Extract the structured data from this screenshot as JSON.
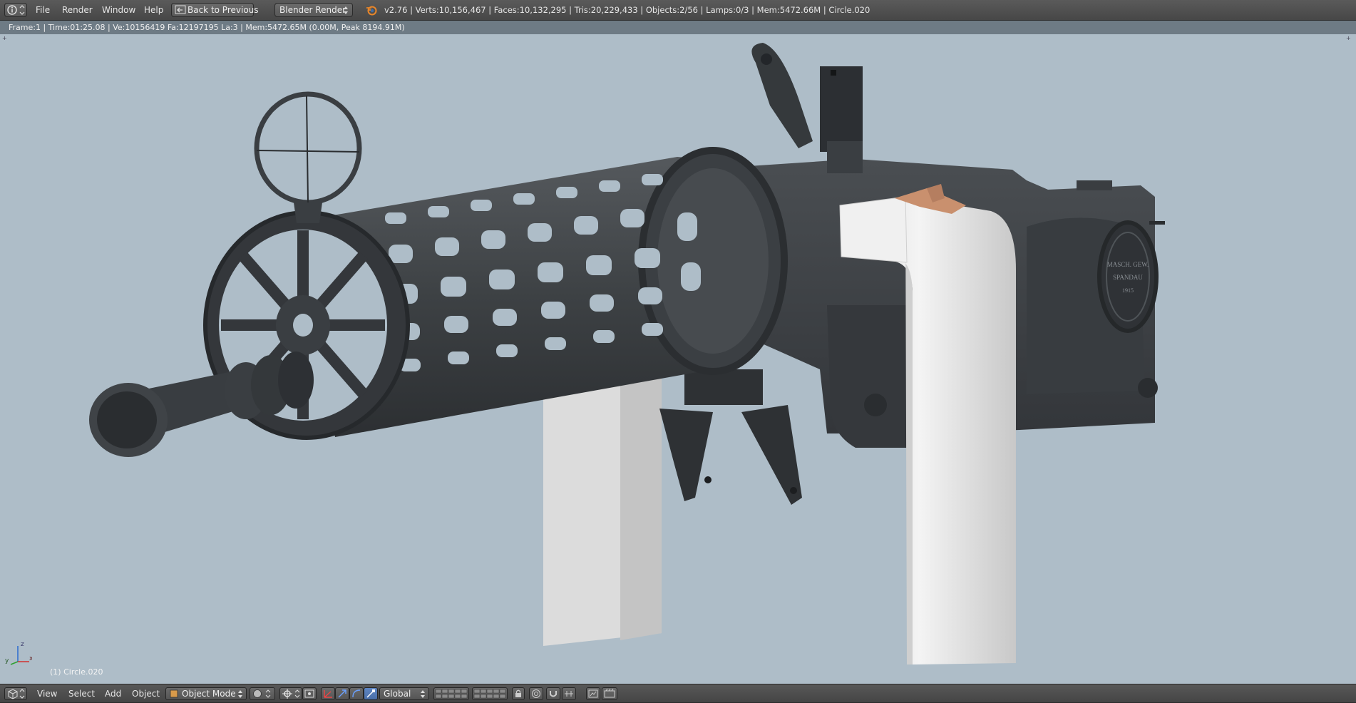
{
  "topbar": {
    "menus": [
      "File",
      "Render",
      "Window",
      "Help"
    ],
    "back_button": "Back to Previous",
    "render_engine": "Blender Render",
    "stats": "v2.76 | Verts:10,156,467 | Faces:10,132,295 | Tris:20,229,433 | Objects:2/56 | Lamps:0/3 | Mem:5472.66M | Circle.020"
  },
  "infobar": {
    "text": "Frame:1 | Time:01:25.08 | Ve:10156419 Fa:12197195 La:3 | Mem:5472.65M (0.00M, Peak 8194.91M)"
  },
  "viewport": {
    "background": "#aebdc8",
    "object_label": "(1) Circle.020",
    "axis": {
      "x": "x",
      "y": "y",
      "z": "z"
    },
    "engraving": {
      "line1": "MASCH. GEW.",
      "line2": "SPANDAU",
      "line3": "1915"
    }
  },
  "bottombar": {
    "menus": [
      "View",
      "Select",
      "Add",
      "Object"
    ],
    "mode": "Object Mode",
    "orientation": "Global"
  },
  "colors": {
    "metal": "#3f4347",
    "metal_dark": "#2c2f32",
    "handle": "#e4e4e4",
    "accent": "#c9906e"
  }
}
